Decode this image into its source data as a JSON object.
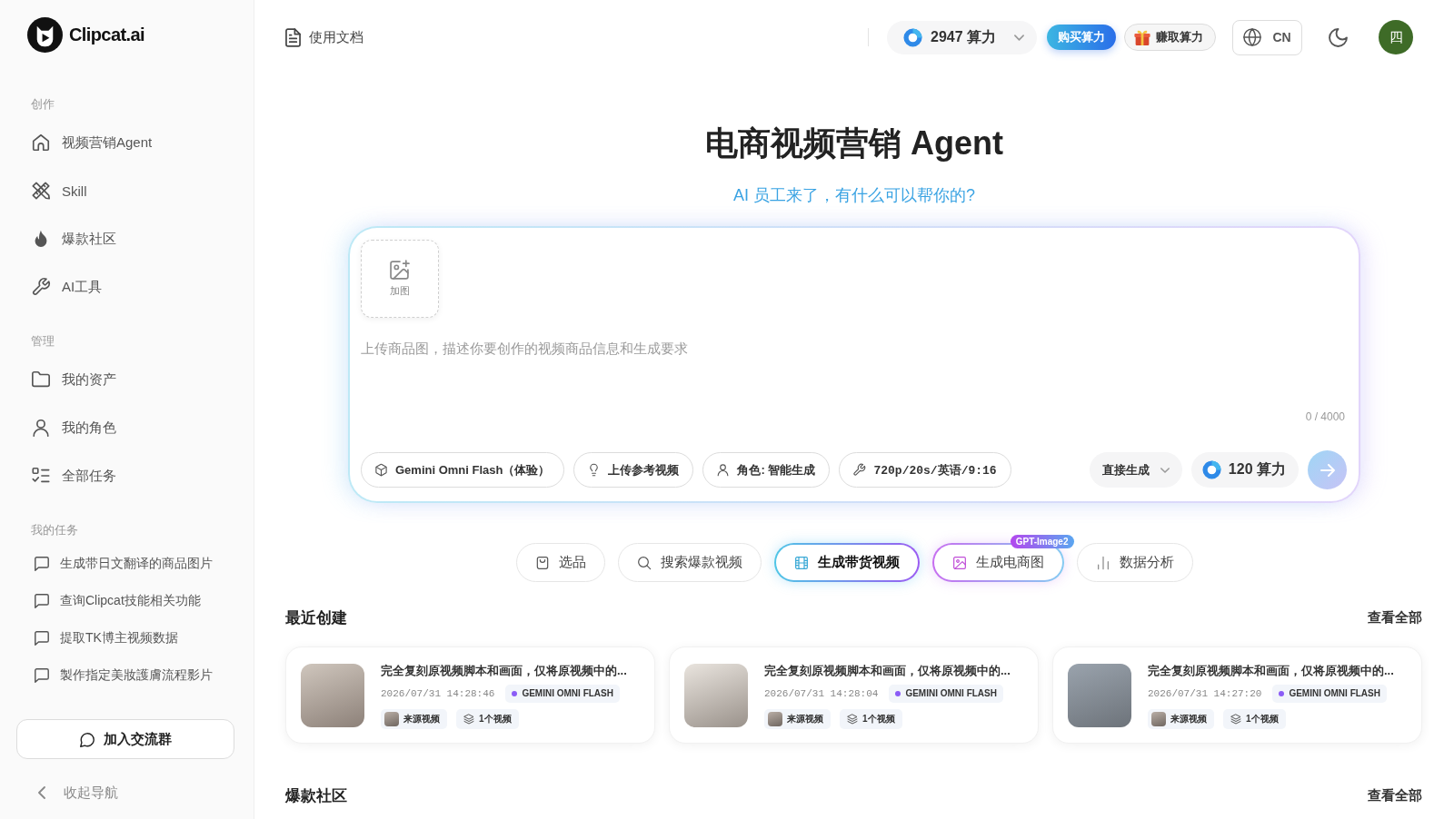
{
  "sidebar": {
    "logo": "Clipcat.ai",
    "sections": [
      {
        "title": "创作",
        "items": [
          {
            "label": "视频营销Agent",
            "kind": "agent",
            "selected": false
          },
          {
            "label": "Skill",
            "kind": "skill",
            "selected": false
          },
          {
            "label": "爆款社区",
            "kind": "community",
            "selected": false
          },
          {
            "label": "AI工具",
            "kind": "tools",
            "selected": false
          }
        ]
      },
      {
        "title": "管理",
        "items": [
          {
            "label": "我的资产",
            "kind": "assets",
            "selected": false
          },
          {
            "label": "我的角色",
            "kind": "roles",
            "selected": false
          },
          {
            "label": "全部任务",
            "kind": "tasks",
            "selected": false
          }
        ]
      }
    ],
    "tasks": {
      "title": "我的任务",
      "items": [
        "生成带日文翻译的商品图片",
        "查询Clipcat技能相关功能",
        "提取TK博主视频数据",
        "製作指定美妝護膚流程影片"
      ]
    },
    "join_button": "加入交流群",
    "collapse": "收起导航"
  },
  "top_bar": {
    "docs_link": "使用文档",
    "credits": "2947 算力",
    "buy_button": "购买算力",
    "earn_button": "赚取算力",
    "language": "CN",
    "avatar": "四"
  },
  "hero": {
    "title": "电商视频营销 Agent",
    "subtitle": "AI 员工来了，有什么可以帮你的?"
  },
  "composer": {
    "add_image": "加图",
    "placeholder": "上传商品图，描述你要创作的视频商品信息和生成要求",
    "counter": "0 / 4000",
    "options": [
      {
        "label": "Gemini Omni Flash（体验）",
        "kind": "model"
      },
      {
        "label": "上传参考视频",
        "kind": "reference"
      },
      {
        "label": "角色: 智能生成",
        "kind": "role"
      },
      {
        "label": "720p/20s/英语/9:16",
        "kind": "settings"
      }
    ],
    "mode": "直接生成",
    "cost": "120 算力"
  },
  "tabs": [
    {
      "label": "选品",
      "kind": "product",
      "selected": false
    },
    {
      "label": "搜索爆款视频",
      "kind": "search",
      "selected": false
    },
    {
      "label": "生成带货视频",
      "kind": "video",
      "selected": true
    },
    {
      "label": "生成电商图",
      "kind": "image",
      "selected": false,
      "badge": "GPT-Image2"
    },
    {
      "label": "数据分析",
      "kind": "analytics",
      "selected": false
    }
  ],
  "recent": {
    "title": "最近创建",
    "view_all": "查看全部",
    "cards": [
      {
        "title": "完全复刻原视频脚本和画面，仅将原视频中的...",
        "time": "2026/07/31 14:28:46",
        "model": "GEMINI OMNI FLASH",
        "source": "来源视频",
        "count": "1个视频"
      },
      {
        "title": "完全复刻原视频脚本和画面，仅将原视频中的...",
        "time": "2026/07/31 14:28:04",
        "model": "GEMINI OMNI FLASH",
        "source": "来源视频",
        "count": "1个视频"
      },
      {
        "title": "完全复刻原视频脚本和画面，仅将原视频中的...",
        "time": "2026/07/31 14:27:20",
        "model": "GEMINI OMNI FLASH",
        "source": "来源视频",
        "count": "1个视频"
      }
    ]
  },
  "community": {
    "title": "爆款社区",
    "view_all": "查看全部"
  }
}
